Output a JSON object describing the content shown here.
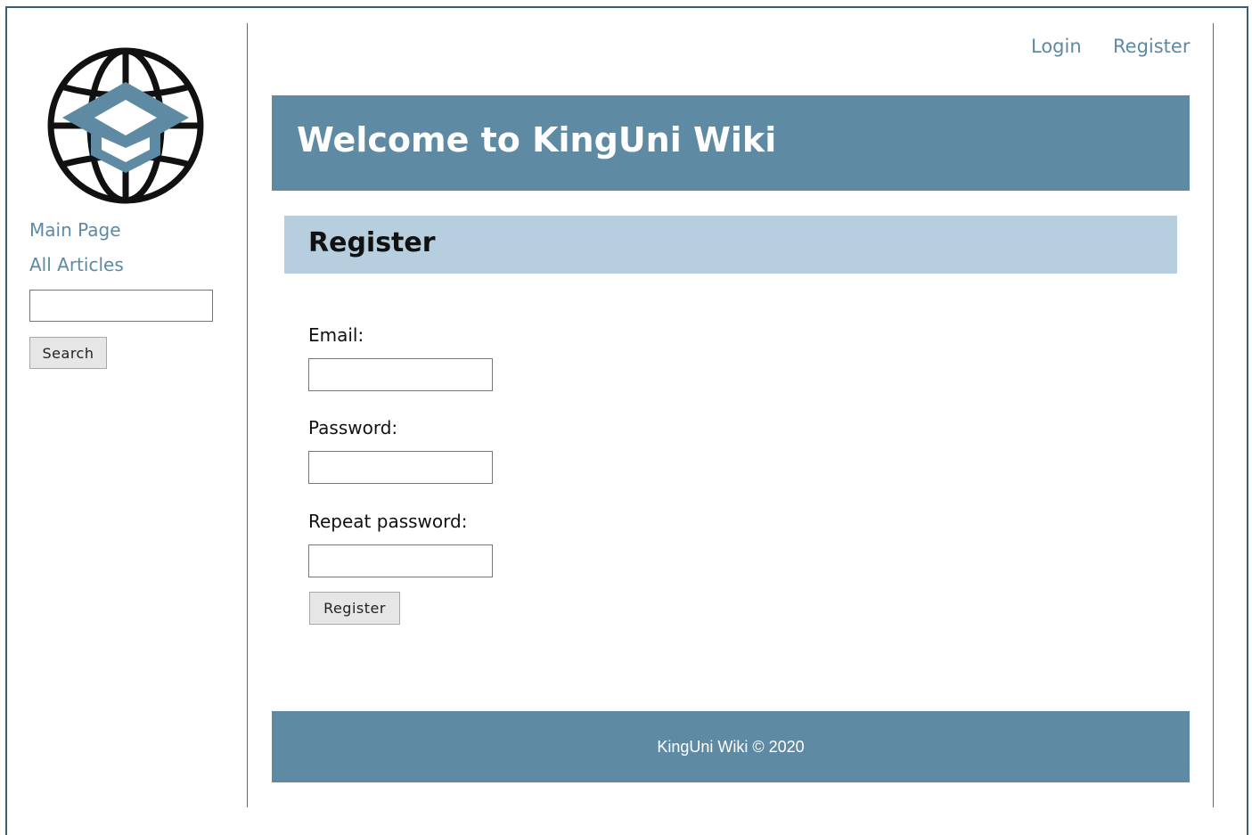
{
  "sidebar": {
    "logo_icon": "globe-graduation-cap-logo",
    "links": [
      "Main Page",
      "All Articles"
    ],
    "search_button_label": "Search"
  },
  "header": {
    "login_label": "Login",
    "register_label": "Register"
  },
  "banner": {
    "title": "Welcome to KingUni Wiki"
  },
  "section": {
    "title": "Register"
  },
  "form": {
    "email_label": "Email:",
    "password_label": "Password:",
    "repeat_password_label": "Repeat password:",
    "submit_label": "Register"
  },
  "footer": {
    "text": "KingUni Wiki © 2020"
  },
  "colors": {
    "accent": "#5e8aa3",
    "section_header": "#b6cedd",
    "link": "#5d89a3"
  }
}
